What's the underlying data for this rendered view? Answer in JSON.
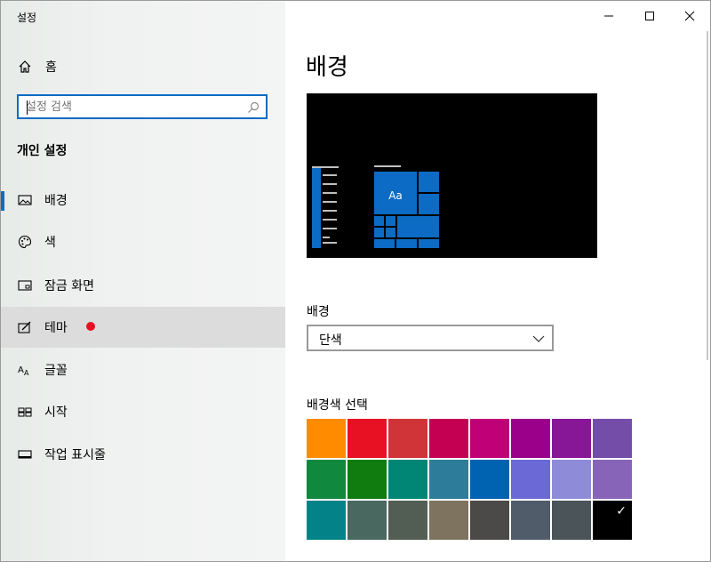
{
  "window": {
    "title": "설정"
  },
  "titlebar": {
    "minimize_icon": "minimize-icon",
    "maximize_icon": "maximize-icon",
    "close_icon": "close-icon"
  },
  "sidebar": {
    "home": {
      "label": "홈",
      "icon": "home-icon"
    },
    "search": {
      "placeholder": "설정 검색",
      "value": ""
    },
    "section_title": "개인 설정",
    "items": [
      {
        "label": "배경",
        "icon": "picture-icon",
        "selected": true
      },
      {
        "label": "색",
        "icon": "palette-icon"
      },
      {
        "label": "잠금 화면",
        "icon": "lock-screen-icon"
      },
      {
        "label": "테마",
        "icon": "theme-icon",
        "hovered": true,
        "badge_color": "#e81123"
      },
      {
        "label": "글꼴",
        "icon": "font-icon"
      },
      {
        "label": "시작",
        "icon": "start-icon"
      },
      {
        "label": "작업 표시줄",
        "icon": "taskbar-icon"
      }
    ]
  },
  "main": {
    "title": "배경",
    "preview": {
      "tile_text": "Aa",
      "accent_color": "#0c6bc4"
    },
    "background_label": "배경",
    "background_select": {
      "value": "단색"
    },
    "color_choice_label": "배경색 선택",
    "colors": [
      "#ff8c00",
      "#e81123",
      "#d13438",
      "#c30052",
      "#bf0077",
      "#9a0089",
      "#881798",
      "#744da9",
      "#10893e",
      "#107c10",
      "#018574",
      "#2d7d9a",
      "#0063b1",
      "#6b69d6",
      "#8e8cd8",
      "#8764b8",
      "#038387",
      "#486860",
      "#525e54",
      "#7e735f",
      "#4c4a48",
      "#515c6b",
      "#4a5459",
      "#000000"
    ],
    "selected_color": "#000000"
  }
}
